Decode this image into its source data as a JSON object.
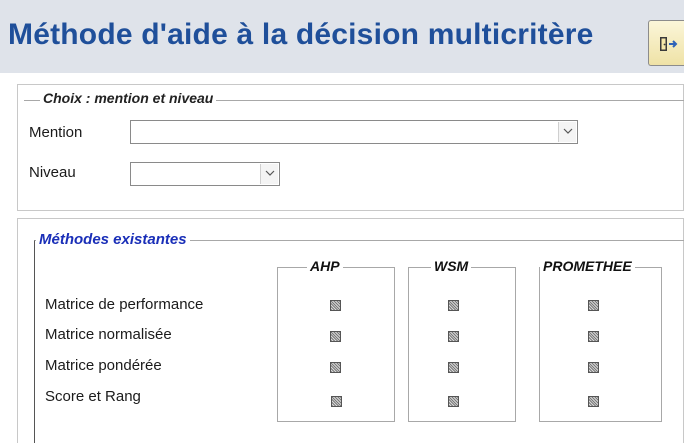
{
  "header": {
    "title": "Méthode d'aide à la décision multicritère",
    "exit_icon": "exit-door-icon"
  },
  "choice_group": {
    "legend": "Choix : mention et niveau",
    "mention_label": "Mention",
    "mention_value": "",
    "niveau_label": "Niveau",
    "niveau_value": ""
  },
  "methods_group": {
    "legend": "Méthodes existantes",
    "columns": [
      "AHP",
      "WSM",
      "PROMETHEE"
    ],
    "rows": [
      "Matrice de performance",
      "Matrice normalisée",
      "Matrice pondérée",
      "Score et Rang"
    ],
    "checkbox_state": "indeterminate"
  },
  "colors": {
    "title": "#1f4f9a",
    "header_background": "#dfe3ea",
    "methods_legend": "#1a2fb8"
  }
}
